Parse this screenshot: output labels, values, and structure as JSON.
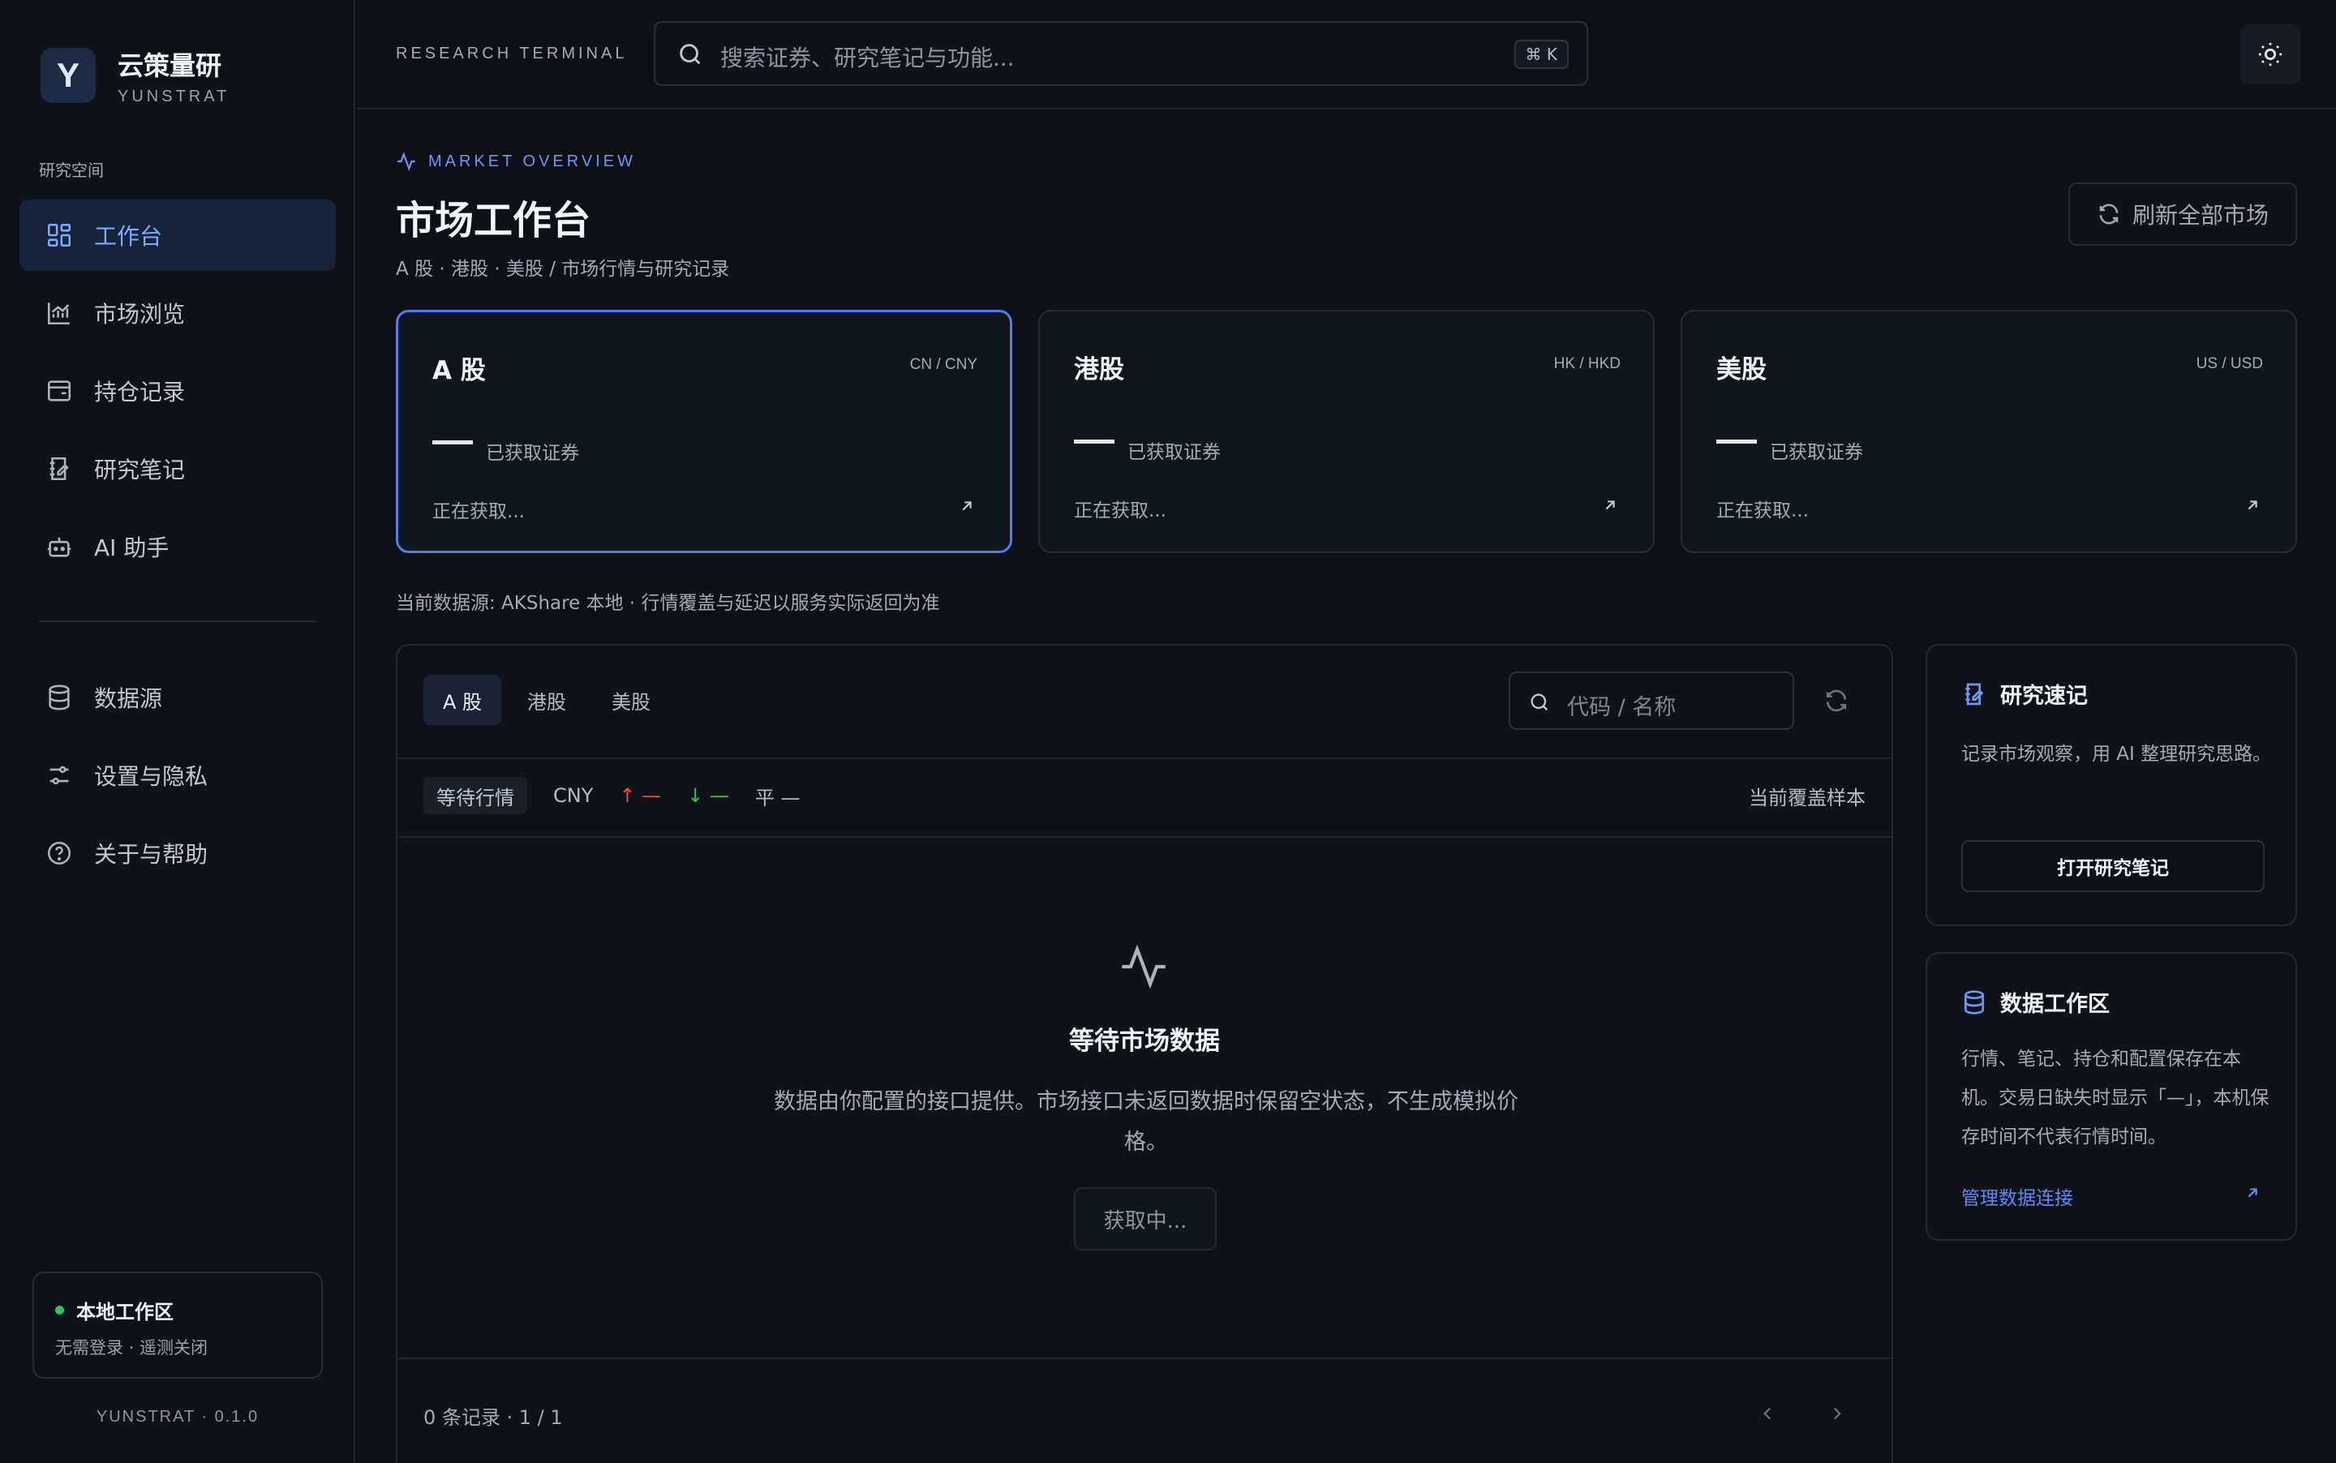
{
  "brand": {
    "logo_letter": "Y",
    "name": "云策量研",
    "sub": "YUNSTRAT"
  },
  "sidebar": {
    "section_label": "研究空间",
    "items": [
      {
        "label": "工作台",
        "icon": "dashboard-icon",
        "active": true
      },
      {
        "label": "市场浏览",
        "icon": "chart-icon"
      },
      {
        "label": "持仓记录",
        "icon": "wallet-icon"
      },
      {
        "label": "研究笔记",
        "icon": "notebook-icon"
      },
      {
        "label": "AI 助手",
        "icon": "bot-icon"
      }
    ],
    "bottom_items": [
      {
        "label": "数据源",
        "icon": "database-icon"
      },
      {
        "label": "设置与隐私",
        "icon": "sliders-icon"
      },
      {
        "label": "关于与帮助",
        "icon": "help-icon"
      }
    ],
    "workspace": {
      "title": "本地工作区",
      "sub": "无需登录 · 遥测关闭",
      "status_color": "#22c55e"
    },
    "version": "YUNSTRAT · 0.1.0"
  },
  "topbar": {
    "label": "RESEARCH TERMINAL",
    "search_placeholder": "搜索证券、研究笔记与功能...",
    "shortcut": "⌘ K"
  },
  "header": {
    "eyebrow": "MARKET OVERVIEW",
    "title": "市场工作台",
    "subtitle": "A 股 · 港股 · 美股 / 市场行情与研究记录",
    "refresh_label": "刷新全部市场"
  },
  "markets": [
    {
      "name": "A 股",
      "code": "CN / CNY",
      "value": "—",
      "value_label": "已获取证券",
      "status": "正在获取...",
      "active": true
    },
    {
      "name": "港股",
      "code": "HK / HKD",
      "value": "—",
      "value_label": "已获取证券",
      "status": "正在获取..."
    },
    {
      "name": "美股",
      "code": "US / USD",
      "value": "—",
      "value_label": "已获取证券",
      "status": "正在获取..."
    }
  ],
  "datasource_note": "当前数据源: AKShare 本地 · 行情覆盖与延迟以服务实际返回为准",
  "table": {
    "tabs": [
      "A 股",
      "港股",
      "美股"
    ],
    "search_placeholder": "代码 / 名称",
    "status_pill": "等待行情",
    "currency": "CNY",
    "up": "↑ —",
    "down": "↓ —",
    "flat": "平 —",
    "coverage": "当前覆盖样本",
    "empty_title": "等待市场数据",
    "empty_desc": "数据由你配置的接口提供。市场接口未返回数据时保留空状态，不生成模拟价格。",
    "fetching": "获取中...",
    "pager": "0 条记录 · 1 / 1"
  },
  "notes_card": {
    "title": "研究速记",
    "desc": "记录市场观察，用 AI 整理研究思路。",
    "button": "打开研究笔记"
  },
  "data_card": {
    "title": "数据工作区",
    "desc": "行情、笔记、持仓和配置保存在本机。交易日缺失时显示「—」，本机保存时间不代表行情时间。",
    "link": "管理数据连接"
  },
  "colors": {
    "accent": "#4f7df5",
    "up": "#ef4444",
    "down": "#22c55e",
    "background": "#0d1016"
  }
}
